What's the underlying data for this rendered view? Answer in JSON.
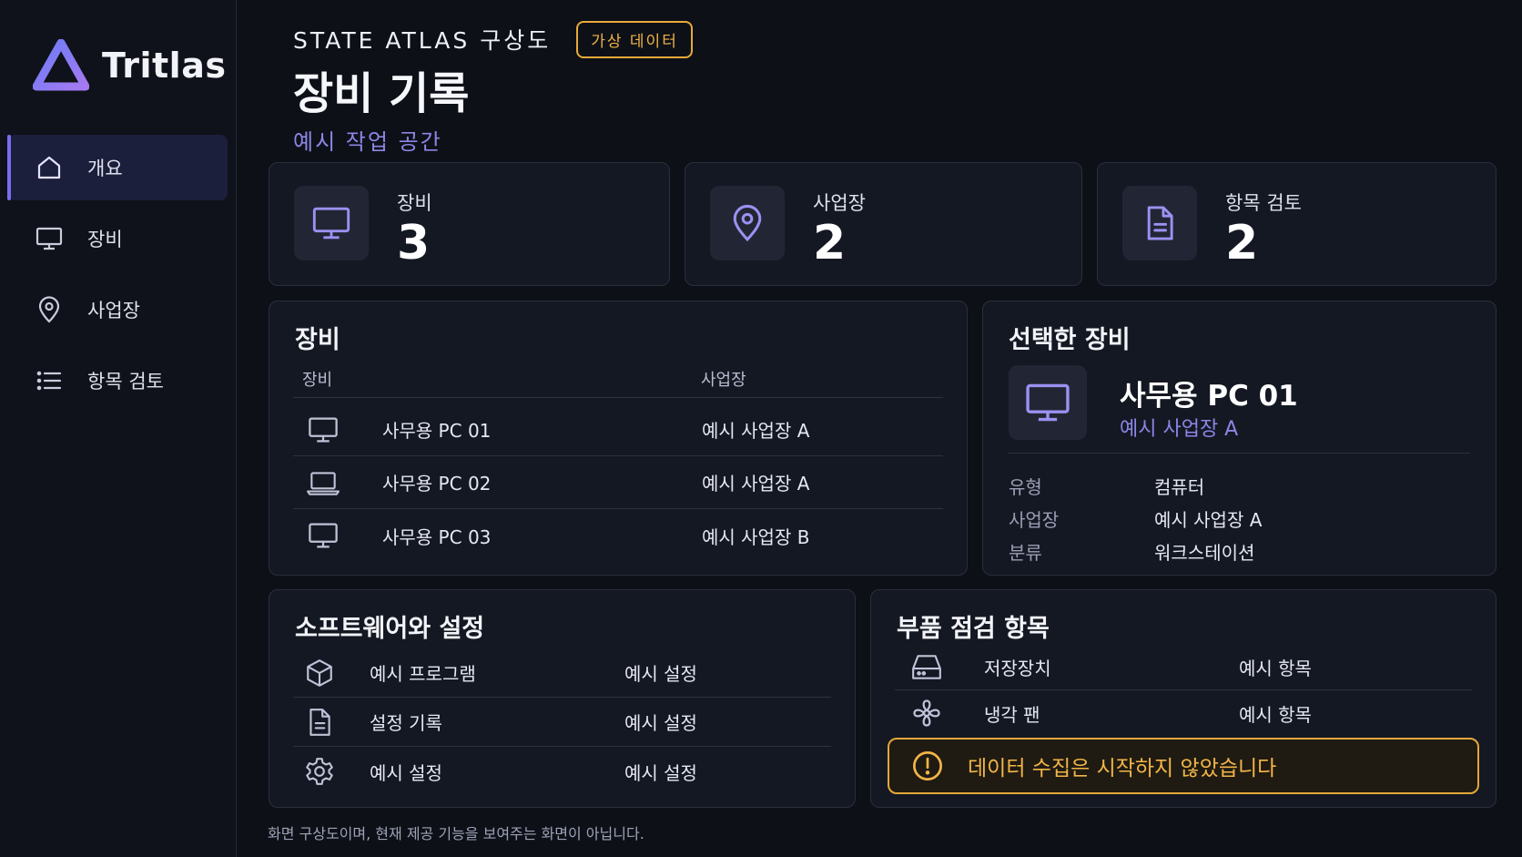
{
  "app": {
    "brand_name": "Tritlas",
    "accent_color": "#7b6cf0",
    "warning_color": "#e3a73a"
  },
  "sidebar": {
    "items": [
      {
        "label": "개요",
        "icon": "home-icon",
        "active": true
      },
      {
        "label": "장비",
        "icon": "monitor-icon",
        "active": false
      },
      {
        "label": "사업장",
        "icon": "map-pin-icon",
        "active": false
      },
      {
        "label": "항목 검토",
        "icon": "list-icon",
        "active": false
      }
    ]
  },
  "header": {
    "kicker": "STATE ATLAS 구상도",
    "badge": "가상 데이터",
    "title": "장비 기록",
    "subtitle": "예시 작업 공간"
  },
  "stats": [
    {
      "label": "장비",
      "value": "3",
      "icon": "monitor-icon"
    },
    {
      "label": "사업장",
      "value": "2",
      "icon": "map-pin-icon"
    },
    {
      "label": "항목 검토",
      "value": "2",
      "icon": "document-icon"
    }
  ],
  "devices": {
    "title": "장비",
    "columns": [
      "장비",
      "사업장"
    ],
    "rows": [
      {
        "name": "사무용 PC 01",
        "site": "예시 사업장 A",
        "icon": "monitor-icon"
      },
      {
        "name": "사무용 PC 02",
        "site": "예시 사업장 A",
        "icon": "laptop-icon"
      },
      {
        "name": "사무용 PC 03",
        "site": "예시 사업장 B",
        "icon": "monitor-icon"
      }
    ]
  },
  "selected": {
    "title": "선택한 장비",
    "name": "사무용 PC 01",
    "site": "예시 사업장 A",
    "fields": [
      {
        "key": "유형",
        "value": "컴퓨터"
      },
      {
        "key": "사업장",
        "value": "예시 사업장 A"
      },
      {
        "key": "분류",
        "value": "워크스테이션"
      }
    ]
  },
  "software": {
    "title": "소프트웨어와 설정",
    "rows": [
      {
        "name": "예시 프로그램",
        "value": "예시 설정",
        "icon": "package-icon"
      },
      {
        "name": "설정 기록",
        "value": "예시 설정",
        "icon": "document-icon"
      },
      {
        "name": "예시 설정",
        "value": "예시 설정",
        "icon": "gear-icon"
      }
    ]
  },
  "parts": {
    "title": "부품 점검 항목",
    "rows": [
      {
        "name": "저장장치",
        "value": "예시 항목",
        "icon": "hard-drive-icon"
      },
      {
        "name": "냉각 팬",
        "value": "예시 항목",
        "icon": "fan-icon"
      }
    ],
    "alert": "데이터 수집은 시작하지 않았습니다"
  },
  "footnote": "화면 구상도이며, 현재 제공 기능을 보여주는 화면이 아닙니다."
}
